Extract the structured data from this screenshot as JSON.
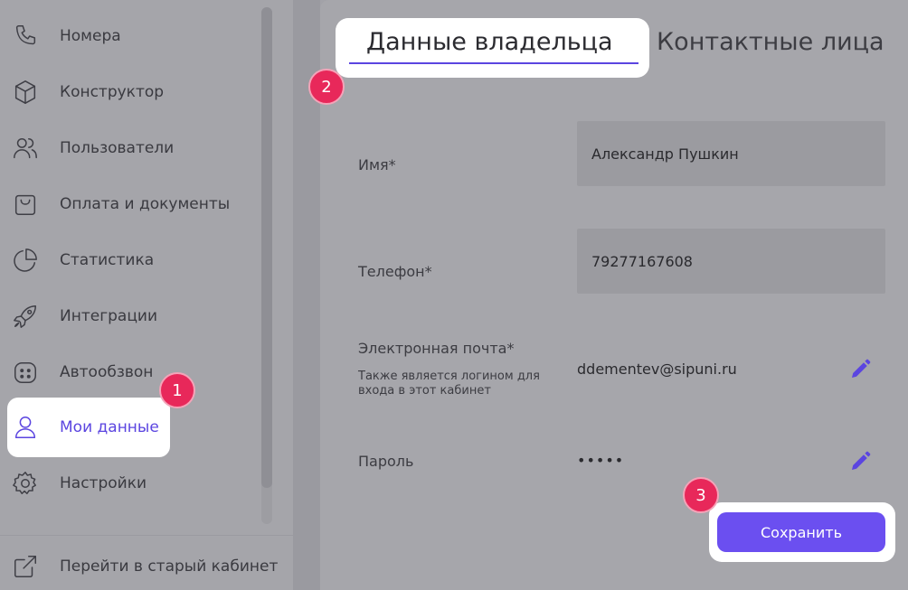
{
  "sidebar": {
    "items": [
      {
        "label": "Номера",
        "icon": "phone-icon"
      },
      {
        "label": "Конструктор",
        "icon": "cube-icon"
      },
      {
        "label": "Пользователи",
        "icon": "users-icon"
      },
      {
        "label": "Оплата и документы",
        "icon": "shopping-bag-icon"
      },
      {
        "label": "Статистика",
        "icon": "pie-chart-icon"
      },
      {
        "label": "Интеграции",
        "icon": "rocket-icon"
      },
      {
        "label": "Автообзвон",
        "icon": "robot-icon"
      },
      {
        "label": "Мои данные",
        "icon": "user-icon",
        "active": true
      },
      {
        "label": "Настройки",
        "icon": "gear-icon"
      }
    ],
    "old_cabinet": {
      "label": "Перейти в старый кабинет",
      "icon": "external-link-icon"
    }
  },
  "tabs": [
    {
      "label": "Данные владельца",
      "active": true
    },
    {
      "label": "Контактные лица",
      "active": false
    }
  ],
  "form": {
    "name": {
      "label": "Имя*",
      "value": "Александр Пушкин"
    },
    "phone": {
      "label": "Телефон*",
      "value": "79277167608"
    },
    "email": {
      "label": "Электронная почта*",
      "hint": "Также является логином для входа в этот кабинет",
      "value": "ddementev@sipuni.ru"
    },
    "password": {
      "label": "Пароль",
      "value": "•••••"
    },
    "save_label": "Сохранить"
  },
  "badges": [
    "1",
    "2",
    "3"
  ],
  "colors": {
    "accent": "#6b4ff0",
    "badge": "#e8285a",
    "overlay": "#a5a5aa"
  }
}
